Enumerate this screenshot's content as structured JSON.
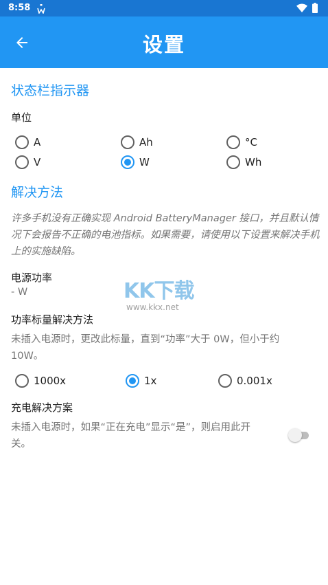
{
  "status_bar": {
    "time": "8:58",
    "notification_icon": "w-notification-icon",
    "wifi_icon": "wifi-icon",
    "battery_icon": "battery-icon"
  },
  "app_bar": {
    "title": "设置",
    "back_icon": "arrow-left-icon",
    "color": "#2196f3"
  },
  "status_bar_indicator": {
    "header": "状态栏指示器",
    "unit_label": "单位",
    "options": [
      "A",
      "Ah",
      "°C",
      "V",
      "W",
      "Wh"
    ],
    "selected": "W"
  },
  "workarounds": {
    "header": "解决方法",
    "description": "许多手机没有正确实现 Android BatteryManager 接口，并且默认情况下会报告不正确的电池指标。如果需要，请使用以下设置来解决手机上的实施缺陷。",
    "power": {
      "label": "电源功率",
      "value": "- W"
    },
    "power_scale": {
      "title": "功率标量解决方法",
      "description": "未插入电源时，更改此标量，直到“功率”大于 0W，但小于约 10W。",
      "options": [
        "1000x",
        "1x",
        "0.001x"
      ],
      "selected": "1x"
    },
    "charging": {
      "title": "充电解决方案",
      "description": "未插入电源时，如果“正在充电”显示“是”，则启用此开关。",
      "enabled": false
    }
  },
  "watermark": {
    "logo": "KK下载",
    "url": "www.kkx.net"
  },
  "accent_color": "#2196f3"
}
